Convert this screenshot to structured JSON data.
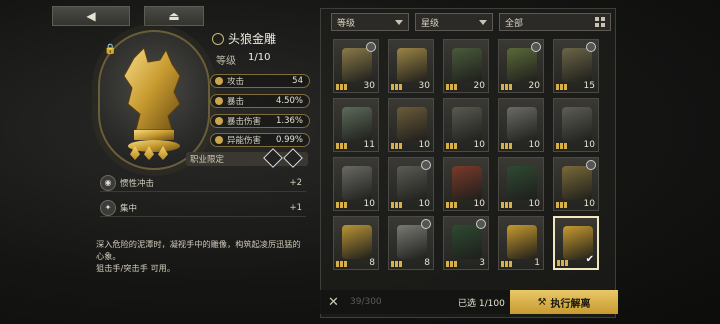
{
  "topbar": {
    "back_icon": "◀",
    "eject_icon": "⏏"
  },
  "item": {
    "name": "头狼金雕",
    "level_label": "等级",
    "level_value": "1/10",
    "stats": [
      {
        "name": "攻击",
        "value": "54"
      },
      {
        "name": "暴击",
        "value": "4.50%"
      },
      {
        "name": "暴击伤害",
        "value": "1.36%"
      },
      {
        "name": "异能伤害",
        "value": "0.99%"
      }
    ],
    "restriction_label": "职业限定",
    "skills": [
      {
        "name": "惯性冲击",
        "value": "+2"
      },
      {
        "name": "集中",
        "value": "+1"
      }
    ],
    "description": "深入危险的泥潭时，凝视手中的雕像，构筑起凌厉迅猛的心象。",
    "classes": "狙击手/突击手 可用。"
  },
  "filters": [
    {
      "label": "等级"
    },
    {
      "label": "星级"
    },
    {
      "label": "全部"
    }
  ],
  "grid": [
    {
      "count": "30",
      "color": "#8a7a4a",
      "badge": true
    },
    {
      "count": "30",
      "color": "#9b8445",
      "badge": false
    },
    {
      "count": "20",
      "color": "#4a5a3a",
      "badge": false
    },
    {
      "count": "20",
      "color": "#5a6a3a",
      "badge": true
    },
    {
      "count": "15",
      "color": "#6b6548",
      "badge": true
    },
    {
      "count": "11",
      "color": "#5d6a5a",
      "badge": false
    },
    {
      "count": "10",
      "color": "#6b5b3a",
      "badge": false
    },
    {
      "count": "10",
      "color": "#5a5a52",
      "badge": false
    },
    {
      "count": "10",
      "color": "#6a6a66",
      "badge": false
    },
    {
      "count": "10",
      "color": "#5e5e58",
      "badge": false
    },
    {
      "count": "10",
      "color": "#6a6a64",
      "badge": false
    },
    {
      "count": "10",
      "color": "#5c5c56",
      "badge": true
    },
    {
      "count": "10",
      "color": "#7a3a2a",
      "badge": false
    },
    {
      "count": "10",
      "color": "#2e4a32",
      "badge": false
    },
    {
      "count": "10",
      "color": "#7a6a3a",
      "badge": true
    },
    {
      "count": "8",
      "color": "#b89436",
      "badge": false
    },
    {
      "count": "8",
      "color": "#7a7a74",
      "badge": true
    },
    {
      "count": "3",
      "color": "#2e4a32",
      "badge": true
    },
    {
      "count": "1",
      "color": "#c79a2f",
      "badge": false
    },
    {
      "count": "",
      "color": "#c79a2f",
      "badge": false
    }
  ],
  "bottom": {
    "close_icon": "✕",
    "capacity": "39/300",
    "selected_label": "已选 1/100",
    "exec_label": "执行解离",
    "exec_icon": "⚒"
  }
}
